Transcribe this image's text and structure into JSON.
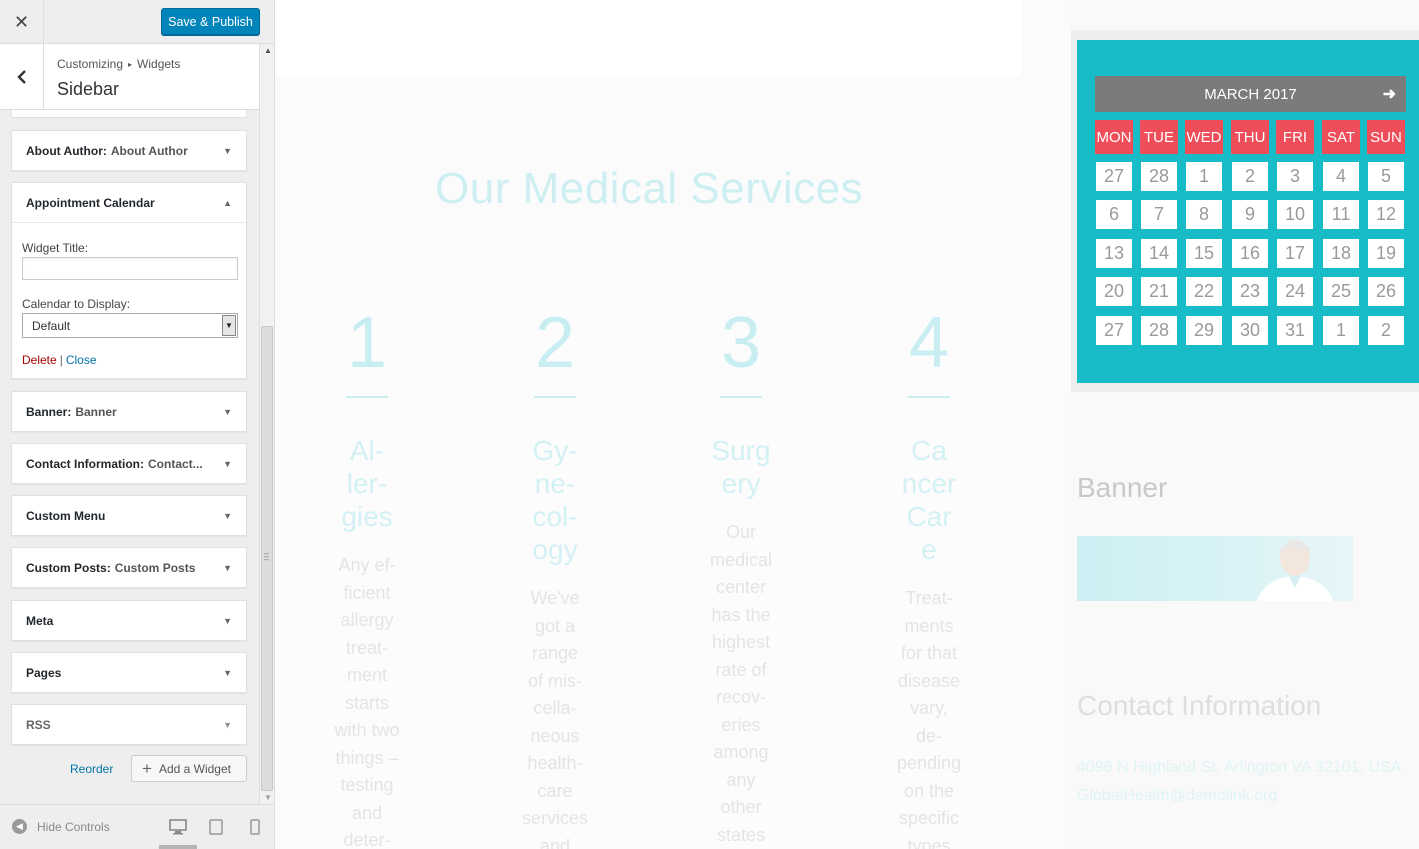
{
  "customizer": {
    "publish_label": "Save & Publish",
    "breadcrumb_root": "Customizing",
    "breadcrumb_child": "Widgets",
    "section_title": "Sidebar",
    "widgets": [
      {
        "name": "About Author",
        "subtitle": "About Author"
      },
      {
        "name": "Banner",
        "subtitle": "Banner"
      },
      {
        "name": "Contact Information",
        "subtitle": "Contact..."
      },
      {
        "name": "Custom Menu",
        "subtitle": ""
      },
      {
        "name": "Custom Posts",
        "subtitle": "Custom Posts"
      },
      {
        "name": "Meta",
        "subtitle": ""
      },
      {
        "name": "Pages",
        "subtitle": ""
      },
      {
        "name": "RSS",
        "subtitle": ""
      }
    ],
    "expanded_widget": {
      "name": "Appointment Calendar",
      "title_label": "Widget Title:",
      "title_value": "",
      "calendar_label": "Calendar to Display:",
      "calendar_value": "Default",
      "delete_label": "Delete",
      "close_label": "Close"
    },
    "reorder_label": "Reorder",
    "add_widget_label": "Add a Widget",
    "hide_controls_label": "Hide Controls"
  },
  "preview": {
    "services_title": "Our Medical Services",
    "services": [
      {
        "number": "1",
        "title": [
          "Al-",
          "ler-",
          "gies"
        ],
        "desc": [
          "Any ef-",
          "ficient",
          "allergy",
          "treat-",
          "ment",
          "starts",
          "with two",
          "things –",
          "testing",
          "and",
          "deter-"
        ]
      },
      {
        "number": "2",
        "title": [
          "Gy-",
          "ne-",
          "col-",
          "ogy"
        ],
        "desc": [
          "We've",
          "got a",
          "range",
          "of mis-",
          "cella-",
          "neous",
          "health-",
          "care",
          "services",
          "and"
        ]
      },
      {
        "number": "3",
        "title": [
          "Surg",
          "ery"
        ],
        "desc": [
          "Our",
          "medical",
          "center",
          "has the",
          "highest",
          "rate of",
          "recov-",
          "eries",
          "among",
          "any",
          "other",
          "states"
        ]
      },
      {
        "number": "4",
        "title": [
          "Ca",
          "ncer",
          "Car",
          "e"
        ],
        "desc": [
          "Treat-",
          "ments",
          "for that",
          "disease",
          "vary,",
          "de-",
          "pending",
          "on the",
          "specific",
          "types"
        ]
      }
    ],
    "calendar": {
      "month": "MARCH 2017",
      "days": [
        "MON",
        "TUE",
        "WED",
        "THU",
        "FRI",
        "SAT",
        "SUN"
      ],
      "weeks": [
        [
          "27",
          "28",
          "1",
          "2",
          "3",
          "4",
          "5"
        ],
        [
          "6",
          "7",
          "8",
          "9",
          "10",
          "11",
          "12"
        ],
        [
          "13",
          "14",
          "15",
          "16",
          "17",
          "18",
          "19"
        ],
        [
          "20",
          "21",
          "22",
          "23",
          "24",
          "25",
          "26"
        ],
        [
          "27",
          "28",
          "29",
          "30",
          "31",
          "1",
          "2"
        ]
      ],
      "colors": {
        "background": "#17bcc7",
        "header": "#7b7b7b",
        "day_names": "#ee4e5a"
      }
    },
    "banner_title": "Banner",
    "contact_title": "Contact Information",
    "contact_text": "4096 N Highland St, Arlington VA 32101, USA GlobalHealth@demolink.org"
  }
}
